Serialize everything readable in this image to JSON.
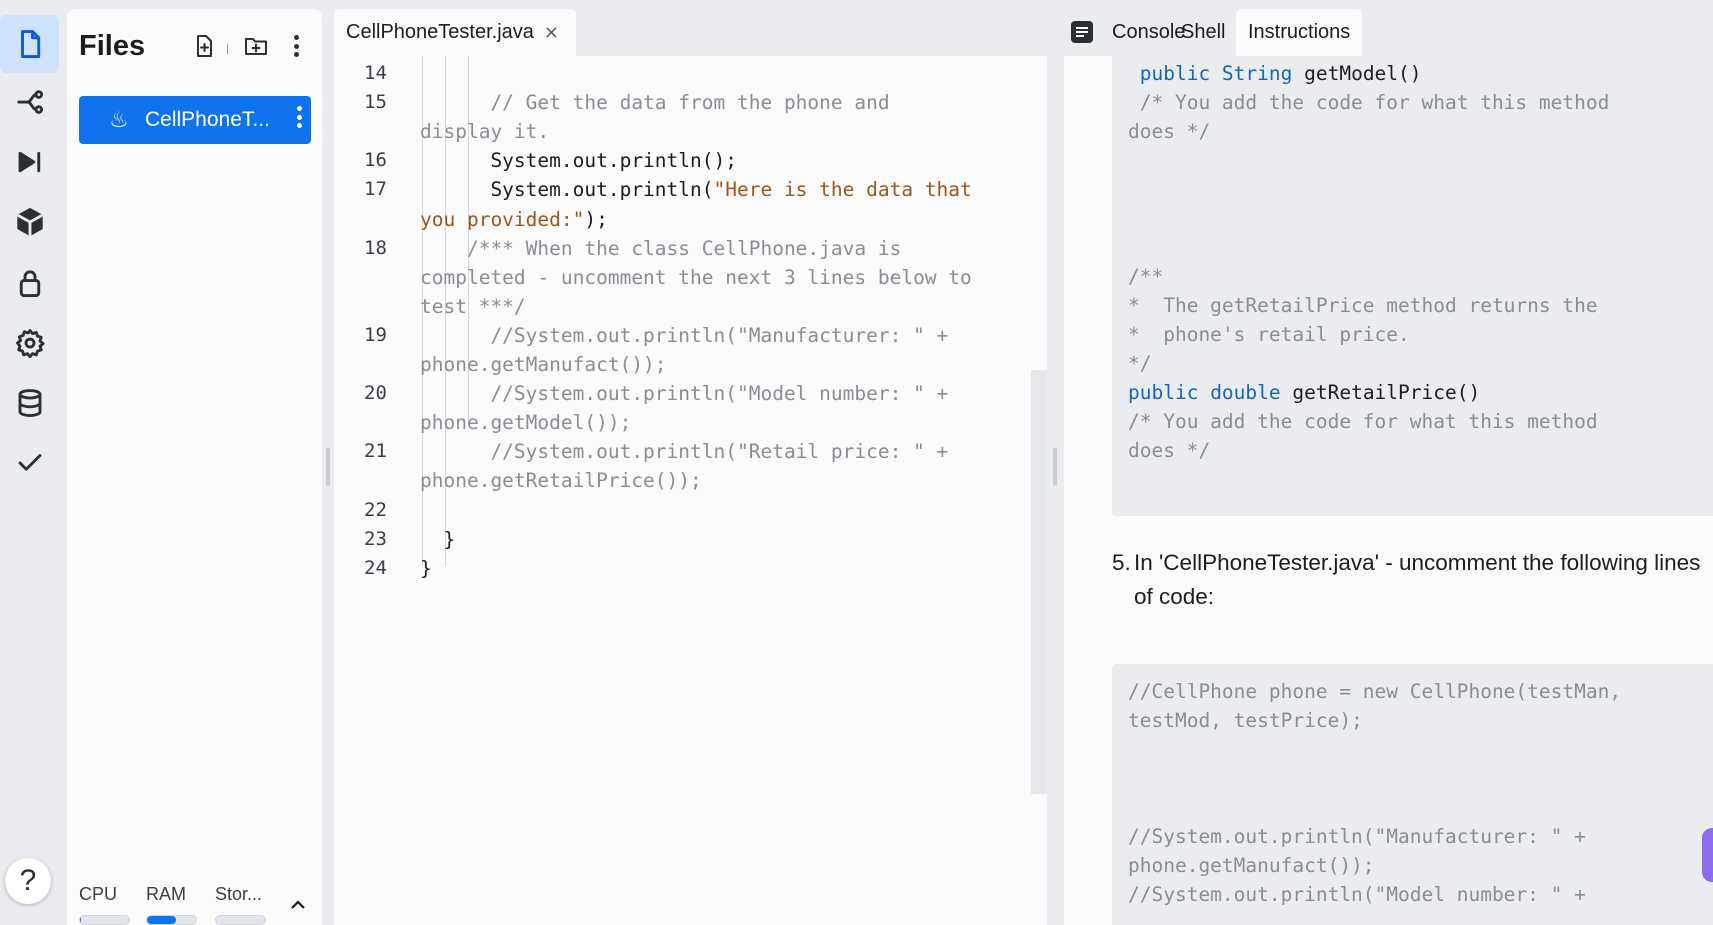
{
  "activity_bar": {
    "items": [
      {
        "name": "files-icon",
        "active": true
      },
      {
        "name": "git-branch-icon",
        "active": false
      },
      {
        "name": "run-step-icon",
        "active": false
      },
      {
        "name": "package-icon",
        "active": false
      },
      {
        "name": "lock-icon",
        "active": false
      },
      {
        "name": "gear-icon",
        "active": false
      },
      {
        "name": "database-icon",
        "active": false
      },
      {
        "name": "checkmark-icon",
        "active": false
      }
    ],
    "help_label": "?"
  },
  "files_panel": {
    "title": "Files",
    "files": [
      {
        "name": "CellPhoneT...",
        "icon": "java-icon",
        "selected": true
      }
    ],
    "resources": [
      {
        "label": "CPU",
        "level_percent": 2
      },
      {
        "label": "RAM",
        "level_percent": 60
      },
      {
        "label": "Stor...",
        "level_percent": 0
      }
    ],
    "accent_color": "#0f72ee"
  },
  "editor": {
    "tab": {
      "label": "CellPhoneTester.java",
      "close": "×"
    },
    "lines": [
      {
        "num": "14",
        "segs": [
          {
            "t": "",
            "c": "p"
          }
        ]
      },
      {
        "num": "15",
        "segs": [
          {
            "t": "      // Get the data from the phone and",
            "c": "cm"
          }
        ]
      },
      {
        "num": "",
        "segs": [
          {
            "t": "display it.",
            "c": "cm"
          }
        ]
      },
      {
        "num": "16",
        "segs": [
          {
            "t": "      System.out.println();",
            "c": "p"
          }
        ]
      },
      {
        "num": "17",
        "segs": [
          {
            "t": "      System.out.println(",
            "c": "p"
          },
          {
            "t": "\"Here is the data that",
            "c": "st"
          }
        ]
      },
      {
        "num": "",
        "segs": [
          {
            "t": "you provided:\"",
            "c": "st"
          },
          {
            "t": ");",
            "c": "p"
          }
        ]
      },
      {
        "num": "18",
        "segs": [
          {
            "t": "    /*** When the class CellPhone.java is",
            "c": "cm"
          }
        ]
      },
      {
        "num": "",
        "segs": [
          {
            "t": "completed - uncomment the next 3 lines below to",
            "c": "cm"
          }
        ]
      },
      {
        "num": "",
        "segs": [
          {
            "t": "test ***/",
            "c": "cm"
          }
        ]
      },
      {
        "num": "19",
        "segs": [
          {
            "t": "      //System.out.println(\"Manufacturer: \" +",
            "c": "cm"
          }
        ]
      },
      {
        "num": "",
        "segs": [
          {
            "t": "phone.getManufact());",
            "c": "cm"
          }
        ]
      },
      {
        "num": "20",
        "segs": [
          {
            "t": "      //System.out.println(\"Model number: \" +",
            "c": "cm"
          }
        ]
      },
      {
        "num": "",
        "segs": [
          {
            "t": "phone.getModel());",
            "c": "cm"
          }
        ]
      },
      {
        "num": "21",
        "segs": [
          {
            "t": "      //System.out.println(\"Retail price: \" +",
            "c": "cm"
          }
        ]
      },
      {
        "num": "",
        "segs": [
          {
            "t": "phone.getRetailPrice());",
            "c": "cm"
          }
        ]
      },
      {
        "num": "22",
        "segs": [
          {
            "t": "",
            "c": "p"
          }
        ]
      },
      {
        "num": "23",
        "segs": [
          {
            "t": "  }",
            "c": "p"
          }
        ]
      },
      {
        "num": "24",
        "segs": [
          {
            "t": "}",
            "c": "p"
          }
        ]
      }
    ]
  },
  "right_panel": {
    "tabs": [
      {
        "label": "Console",
        "active": false
      },
      {
        "label": "Shell",
        "active": false
      },
      {
        "label": "Instructions",
        "active": true
      }
    ],
    "code_box_1": [
      [
        {
          "t": " public ",
          "c": "kw"
        },
        {
          "t": "String",
          "c": "kw"
        },
        {
          "t": " getModel()",
          "c": "p"
        }
      ],
      [
        {
          "t": " /* You add the code for what this method",
          "c": "cm"
        }
      ],
      [
        {
          "t": "does */",
          "c": "cm"
        }
      ],
      [
        {
          "t": "",
          "c": "p"
        }
      ],
      [
        {
          "t": "",
          "c": "p"
        }
      ],
      [
        {
          "t": "",
          "c": "p"
        }
      ],
      [
        {
          "t": "",
          "c": "p"
        }
      ],
      [
        {
          "t": "/**",
          "c": "cm"
        }
      ],
      [
        {
          "t": "*  The getRetailPrice method returns the",
          "c": "cm"
        }
      ],
      [
        {
          "t": "*  phone's retail price.",
          "c": "cm"
        }
      ],
      [
        {
          "t": "*/",
          "c": "cm"
        }
      ],
      [
        {
          "t": "public ",
          "c": "kw"
        },
        {
          "t": "double",
          "c": "kw"
        },
        {
          "t": " getRetailPrice()",
          "c": "p"
        }
      ],
      [
        {
          "t": "/* You add the code for what this method",
          "c": "cm"
        }
      ],
      [
        {
          "t": "does */",
          "c": "cm"
        }
      ]
    ],
    "step": {
      "number": "5.",
      "text": "In 'CellPhoneTester.java' - uncomment the following lines of code:"
    },
    "code_box_2": [
      [
        {
          "t": "//CellPhone phone = new CellPhone(testMan,",
          "c": "cm"
        }
      ],
      [
        {
          "t": "testMod, testPrice);",
          "c": "cm"
        }
      ],
      [
        {
          "t": "",
          "c": "p"
        }
      ],
      [
        {
          "t": "",
          "c": "p"
        }
      ],
      [
        {
          "t": "",
          "c": "p"
        }
      ],
      [
        {
          "t": "//System.out.println(\"Manufacturer: \" +",
          "c": "cm"
        }
      ],
      [
        {
          "t": "phone.getManufact());",
          "c": "cm"
        }
      ],
      [
        {
          "t": "//System.out.println(\"Model number: \" +",
          "c": "cm"
        }
      ]
    ]
  }
}
